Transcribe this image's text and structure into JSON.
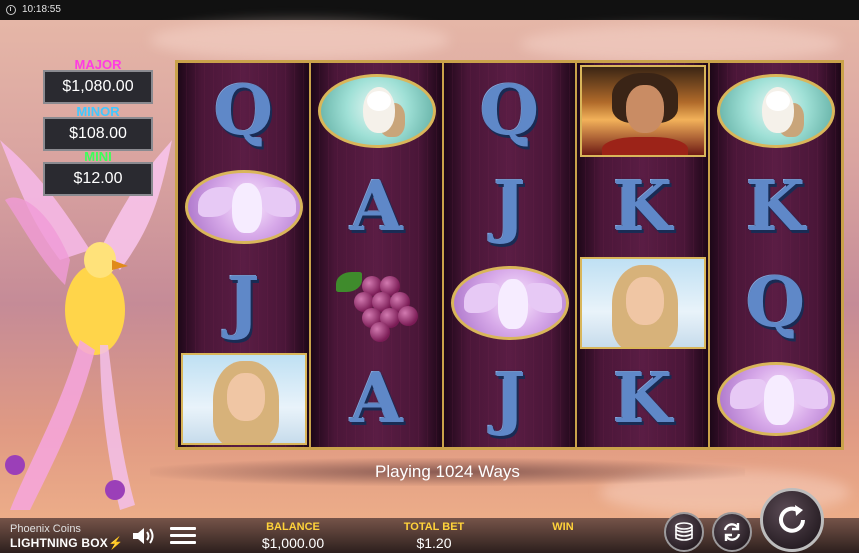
{
  "status_bar": {
    "time": "10:18:55"
  },
  "jackpots": {
    "major": {
      "label": "MAJOR",
      "amount": "$1,080.00"
    },
    "minor": {
      "label": "MINOR",
      "amount": "$108.00"
    },
    "mini": {
      "label": "MINI",
      "amount": "$12.00"
    }
  },
  "reels": [
    [
      "Q",
      "horse-symbol",
      "J",
      "woman-symbol"
    ],
    [
      "owl-symbol",
      "A",
      "grapes-symbol",
      "A"
    ],
    [
      "Q",
      "J",
      "horse-symbol",
      "J"
    ],
    [
      "man-symbol",
      "K",
      "woman-symbol",
      "K"
    ],
    [
      "owl-symbol",
      "K",
      "Q",
      "horse-symbol"
    ]
  ],
  "ways_text": "Playing 1024 Ways",
  "footer": {
    "game_name": "Phoenix Coins",
    "brand": "LIGHTNING BOX",
    "balance_label": "BALANCE",
    "balance_value": "$1,000.00",
    "bet_label": "TOTAL BET",
    "bet_value": "$1.20",
    "win_label": "WIN",
    "win_value": ""
  },
  "colors": {
    "major": "#ff3be2",
    "minor": "#41c8ff",
    "mini": "#3cff5a",
    "gold_frame": "#c9a24a",
    "footer_label": "#ffd23a"
  }
}
